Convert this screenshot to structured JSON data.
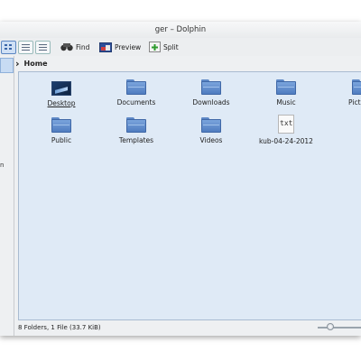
{
  "window": {
    "title": "ger – Dolphin"
  },
  "toolbar": {
    "find_label": "Find",
    "preview_label": "Preview",
    "split_label": "Split"
  },
  "sidebar": {
    "partial_label": "n"
  },
  "breadcrumb": {
    "location": "Home",
    "chevron": "›"
  },
  "items": [
    {
      "name": "Desktop",
      "icon": "desktop-icon"
    },
    {
      "name": "Documents",
      "icon": "folder-icon"
    },
    {
      "name": "Downloads",
      "icon": "folder-icon"
    },
    {
      "name": "Music",
      "icon": "folder-icon"
    },
    {
      "name": "Pictu",
      "icon": "folder-icon"
    },
    {
      "name": "Public",
      "icon": "folder-icon"
    },
    {
      "name": "Templates",
      "icon": "folder-icon"
    },
    {
      "name": "Videos",
      "icon": "folder-icon"
    },
    {
      "name": "kub-04-24-2012",
      "icon": "text-file-icon",
      "glyph": "txt"
    }
  ],
  "status": {
    "summary": "8 Folders, 1 File (33.7 KiB)"
  }
}
